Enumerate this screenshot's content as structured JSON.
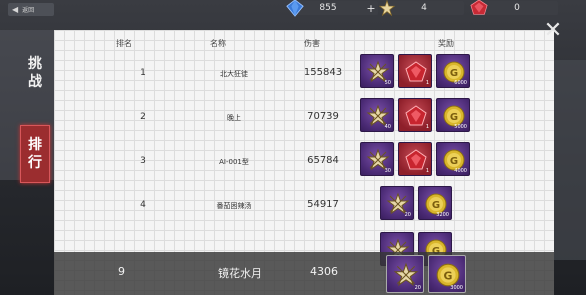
{
  "top_bar": {
    "back_label": "返回",
    "gems": "855",
    "medals": "4",
    "rubies": "0"
  },
  "side_tabs": {
    "challenge": [
      "挑",
      "战"
    ],
    "rank": [
      "排",
      "行"
    ]
  },
  "table": {
    "headers": {
      "rank": "排名",
      "name": "名称",
      "damage": "伤害",
      "reward": "奖励"
    },
    "rows": [
      {
        "rank": "1",
        "name": "北大狂徒",
        "damage": "155843",
        "rewards": [
          {
            "icon": "medal-icon",
            "count": "50"
          },
          {
            "icon": "ruby-icon",
            "count": "1"
          },
          {
            "icon": "gold-coin-icon",
            "count": "6000"
          }
        ]
      },
      {
        "rank": "2",
        "name": "晚上",
        "damage": "70739",
        "rewards": [
          {
            "icon": "medal-icon",
            "count": "40"
          },
          {
            "icon": "ruby-icon",
            "count": "1"
          },
          {
            "icon": "gold-coin-icon",
            "count": "5000"
          }
        ]
      },
      {
        "rank": "3",
        "name": "AI-001型",
        "damage": "65784",
        "rewards": [
          {
            "icon": "medal-icon",
            "count": "30"
          },
          {
            "icon": "ruby-icon",
            "count": "1"
          },
          {
            "icon": "gold-coin-icon",
            "count": "4000"
          }
        ]
      },
      {
        "rank": "4",
        "name": "番茄困辣汤",
        "damage": "54917",
        "rewards": [
          {
            "icon": "medal-icon",
            "count": "20"
          },
          {
            "icon": "gold-coin-icon",
            "count": "3200"
          }
        ]
      }
    ]
  },
  "my_entry": {
    "rank": "9",
    "name": "镜花水月",
    "damage": "4306",
    "rewards": [
      {
        "icon": "medal-icon",
        "count": "20"
      },
      {
        "icon": "gold-coin-icon",
        "count": "3000"
      }
    ]
  }
}
